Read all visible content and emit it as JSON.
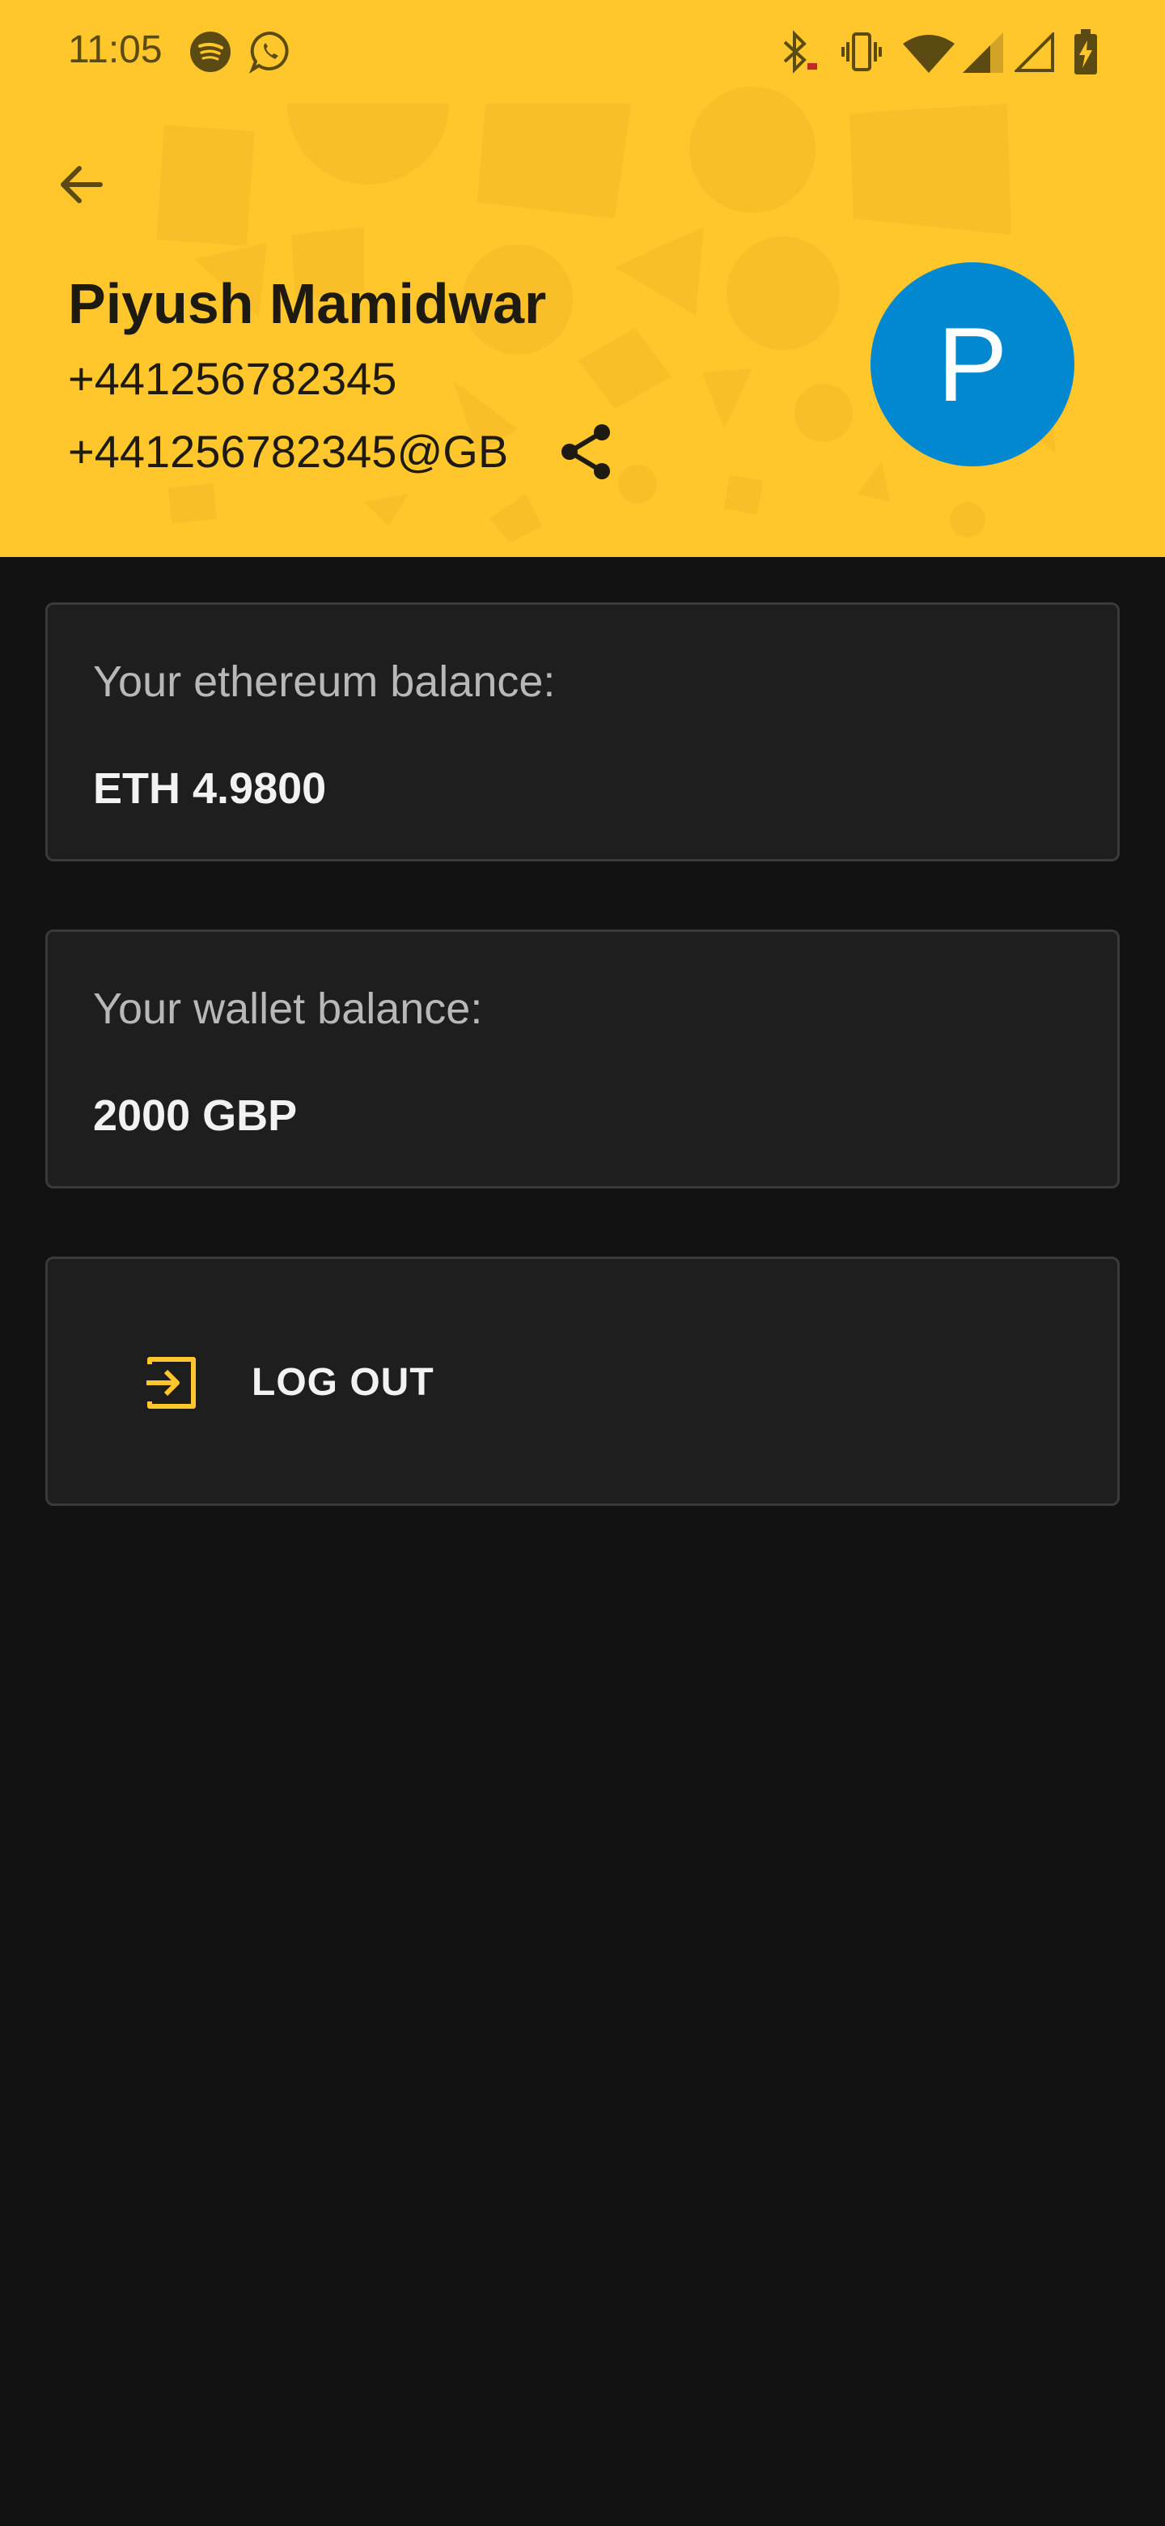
{
  "status_bar": {
    "time": "11:05",
    "left_icons": [
      "spotify-icon",
      "whatsapp-icon"
    ],
    "right_icons": [
      "bluetooth-icon",
      "vibrate-icon",
      "wifi-icon",
      "signal-icon",
      "signal-empty-icon",
      "battery-charging-icon"
    ]
  },
  "header": {
    "background_color": "#FFC72C",
    "back_icon": "arrow-back-icon",
    "name": "Piyush Mamidwar",
    "phone": "+441256782345",
    "account_id": "+441256782345@GB",
    "share_icon": "share-icon",
    "avatar_letter": "P",
    "avatar_color": "#0288D1"
  },
  "cards": {
    "eth": {
      "label": "Your ethereum balance:",
      "value": "ETH 4.9800"
    },
    "wallet": {
      "label": "Your wallet balance:",
      "value": "2000 GBP"
    }
  },
  "logout": {
    "icon": "logout-icon",
    "label": "LOG OUT",
    "icon_color": "#FFC72C"
  }
}
